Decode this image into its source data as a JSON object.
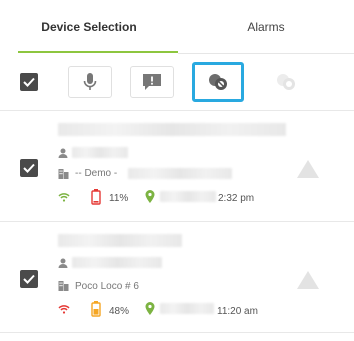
{
  "tabs": [
    {
      "label": "Device Selection"
    },
    {
      "label": "Alarms"
    }
  ],
  "toolbar": {
    "buttons": [
      {
        "icon": "microphone-icon"
      },
      {
        "icon": "message-alert-icon"
      },
      {
        "icon": "channels-icon"
      },
      {
        "icon": "channels-disabled-icon"
      }
    ]
  },
  "devices": [
    {
      "group": "-- Demo -",
      "battery": "11%",
      "battery_level": 0.11,
      "battery_color": "#e53935",
      "signal_color": "#7cb342",
      "time": "2:32 pm"
    },
    {
      "group": "Poco Loco # 6",
      "battery": "48%",
      "battery_level": 0.48,
      "battery_color": "#f5a623",
      "signal_color": "#e53935",
      "time": "11:20 am"
    }
  ],
  "colors": {
    "accent": "#8dc63f",
    "selected_border": "#29a9e0",
    "checkbox": "#4a4a4a"
  }
}
